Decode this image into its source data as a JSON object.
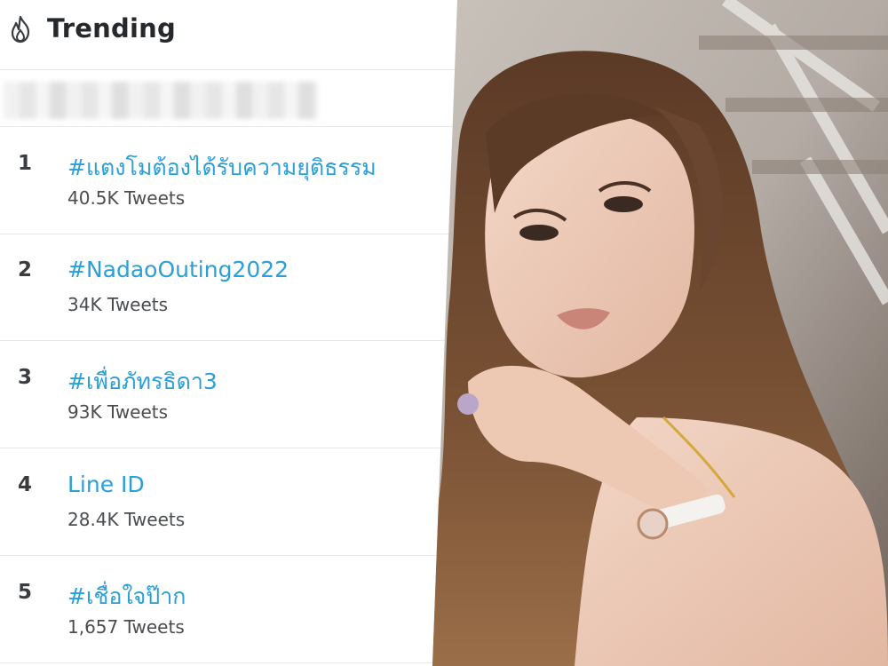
{
  "header": {
    "title": "Trending",
    "icon": "flame-icon"
  },
  "trends": [
    {
      "rank": "1",
      "tag": "#แตงโมต้องได้รับความยุติธรรม",
      "count": "40.5K Tweets"
    },
    {
      "rank": "2",
      "tag": "#NadaoOuting2022",
      "count": "34K Tweets"
    },
    {
      "rank": "3",
      "tag": "#เพื่อภัทรธิดา3",
      "count": "93K Tweets"
    },
    {
      "rank": "4",
      "tag": "Line ID",
      "count": "28.4K Tweets"
    },
    {
      "rank": "5",
      "tag": "#เชื่อใจป๊าก",
      "count": "1,657 Tweets"
    }
  ],
  "colors": {
    "link": "#2a9fd8",
    "divider": "#e6e9ec",
    "text": "#26292c"
  }
}
